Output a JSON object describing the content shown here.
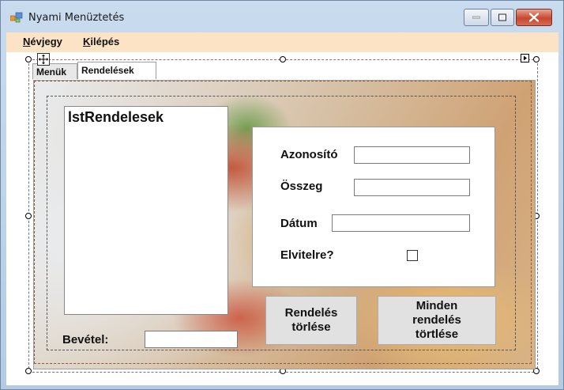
{
  "window": {
    "title": "Nyami Menüztetés",
    "colors": {
      "menubar": "#fde3c6",
      "close_button": "#c6472f"
    }
  },
  "menu": {
    "items": [
      {
        "underlined": "N",
        "rest": "évjegy"
      },
      {
        "underlined": "K",
        "rest": "ilépés"
      }
    ]
  },
  "tabs": [
    {
      "label": "Menük",
      "selected": false
    },
    {
      "label": "Rendelések",
      "selected": true
    }
  ],
  "listbox": {
    "label": "lstRendelesek"
  },
  "form": {
    "azonosito_label": "Azonosító",
    "azonosito_value": "",
    "osszeg_label": "Összeg",
    "osszeg_value": "",
    "datum_label": "Dátum",
    "datum_value": "",
    "elvitelre_label": "Elvitelre?",
    "elvitelre_checked": false
  },
  "buttons": {
    "delete_order": "Rendelés\ntörlése",
    "delete_all_orders": "Minden\nrendelés\ntörtlése"
  },
  "bevetel": {
    "label": "Bevétel:",
    "value": ""
  }
}
